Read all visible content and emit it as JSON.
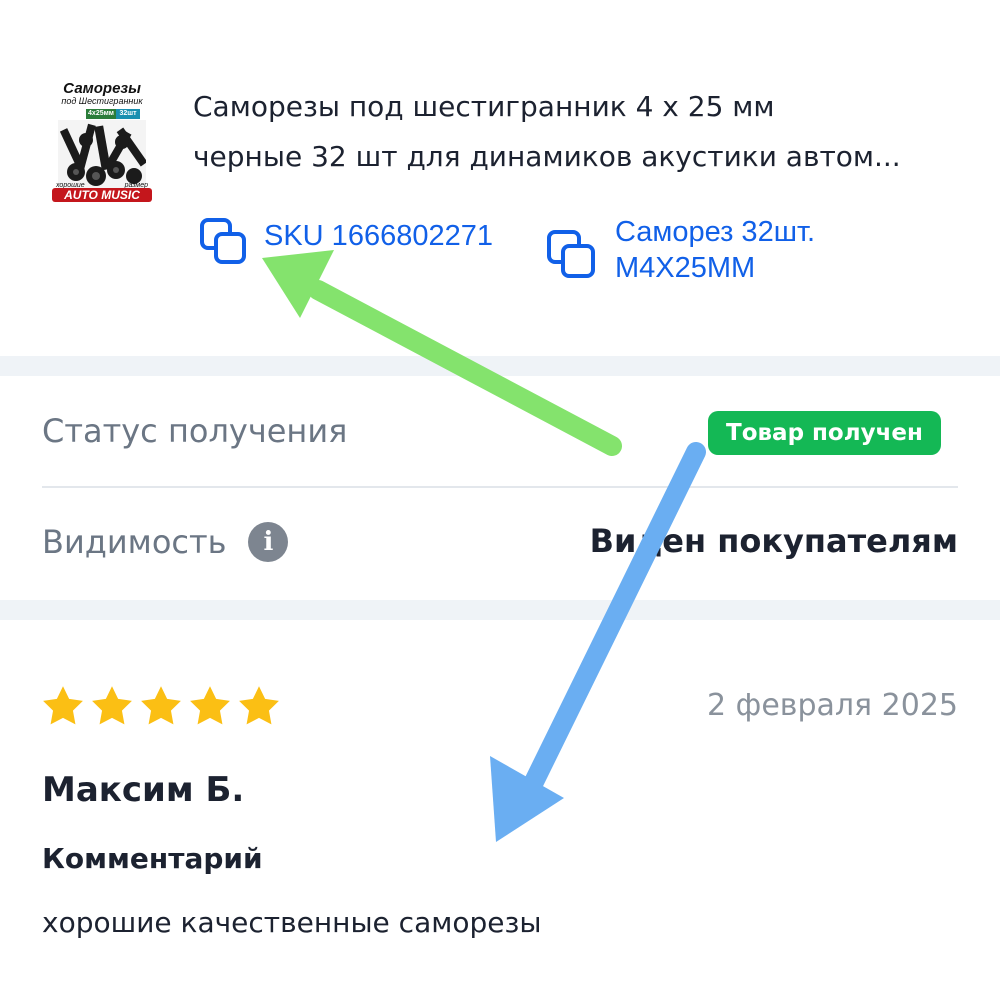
{
  "product": {
    "thumbnail": {
      "title": "Саморезы",
      "subtitle": "под Шестигранник",
      "size_tag": "4x25мм",
      "count_tag": "32шт",
      "caption_left": "хорошие",
      "caption_right": "размер",
      "brand": "AUTO MUSIC"
    },
    "title_lines": [
      "Саморезы под шестигранник 4 х 25 мм",
      "черные 32 шт для динамиков акустики автом..."
    ],
    "sku_label": "SKU 1666802271",
    "article_lines": [
      "Саморез 32шт.",
      "M4X25MM"
    ],
    "copy_icon": "copy-icon"
  },
  "status": {
    "label": "Статус получения",
    "badge": "Товар получен",
    "badge_color": "#14b855"
  },
  "visibility": {
    "label": "Видимость",
    "info_icon": "info-icon",
    "value": "Виден покупателям"
  },
  "review": {
    "rating": 5,
    "max_rating": 5,
    "star_color": "#fbbf14",
    "date": "2 февраля 2025",
    "author": "Максим Б.",
    "comment_heading": "Комментарий",
    "comment_text": "хорошие качественные саморезы"
  },
  "annotations": {
    "green_arrow_color": "#84e36d",
    "blue_arrow_color": "#6aaef2"
  }
}
